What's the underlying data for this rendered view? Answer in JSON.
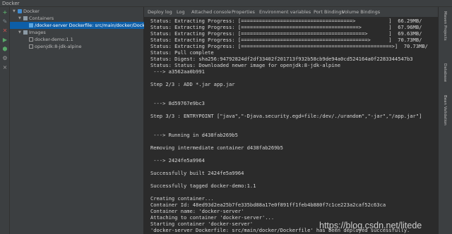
{
  "window": {
    "title": "Docker"
  },
  "toolbar": {
    "icons": [
      "add-icon",
      "edit-icon",
      "delete-icon",
      "play-icon",
      "deploy-icon",
      "settings-icon",
      "close-icon"
    ]
  },
  "tree": {
    "root": "Docker",
    "containers_label": "Containers",
    "container_item": "/docker-server Dockerfile: src/main/docker/Dockerfile",
    "images_label": "Images",
    "images": [
      "docker-demo:1.1",
      "openjdk:8-jdk-alpine"
    ]
  },
  "tabs": [
    "Deploy log",
    "Log",
    "Attached console",
    "Properties",
    "Environment variables",
    "Port Bindings",
    "Volume Bindings"
  ],
  "console": {
    "lines": [
      "Status: Extracting Progress: [=====================================>           ]  66.29MB/",
      "Status: Extracting Progress: [=======================================>         ]  67.96MB/",
      "Status: Extracting Progress: [=========================================>       ]  69.63MB/",
      "Status: Extracting Progress: [==========================================>      ]  70.73MB/",
      "Status: Extracting Progress: [==================================================>]  70.73MB/",
      "Status: Pull complete",
      "Status: Digest: sha256:94792824df2df33402f201713f932b58cb9de94a0cd524164a0f2283344547b3",
      "Status: Status: Downloaded newer image for openjdk:8-jdk-alpine",
      " ---> a3562aa0b991",
      "",
      "Step 2/3 : ADD *.jar app.jar",
      "",
      "",
      " ---> 8d59767e9bc3",
      "",
      "Step 3/3 : ENTRYPOINT [\"java\",\"-Djava.security.egd=file:/dev/./urandom\",\"-jar\",\"/app.jar\"]",
      "",
      "",
      " ---> Running in d438fab269b5",
      "",
      "Removing intermediate container d438fab269b5",
      "",
      " ---> 2424fe5a9964",
      "",
      "Successfully built 2424fe5a9964",
      "",
      "Successfully tagged docker-demo:1.1",
      "",
      "Creating container...",
      "Container Id: 48ed93d2ea25b7fe335bd88a17e0f891ff1feb4b880f7c1ce223a2caf52c63ca",
      "Container name: 'docker-server'",
      "Attaching to container 'docker-server'...",
      "Starting container 'docker-server'",
      "'docker-server Dockerfile: src/main/docker/Dockerfile' has been deployed successfully."
    ]
  },
  "rightbar": {
    "labels": [
      "Maven Projects",
      "Database",
      "Bean Validation"
    ]
  },
  "watermark": "https://blog.csdn.net/litede"
}
